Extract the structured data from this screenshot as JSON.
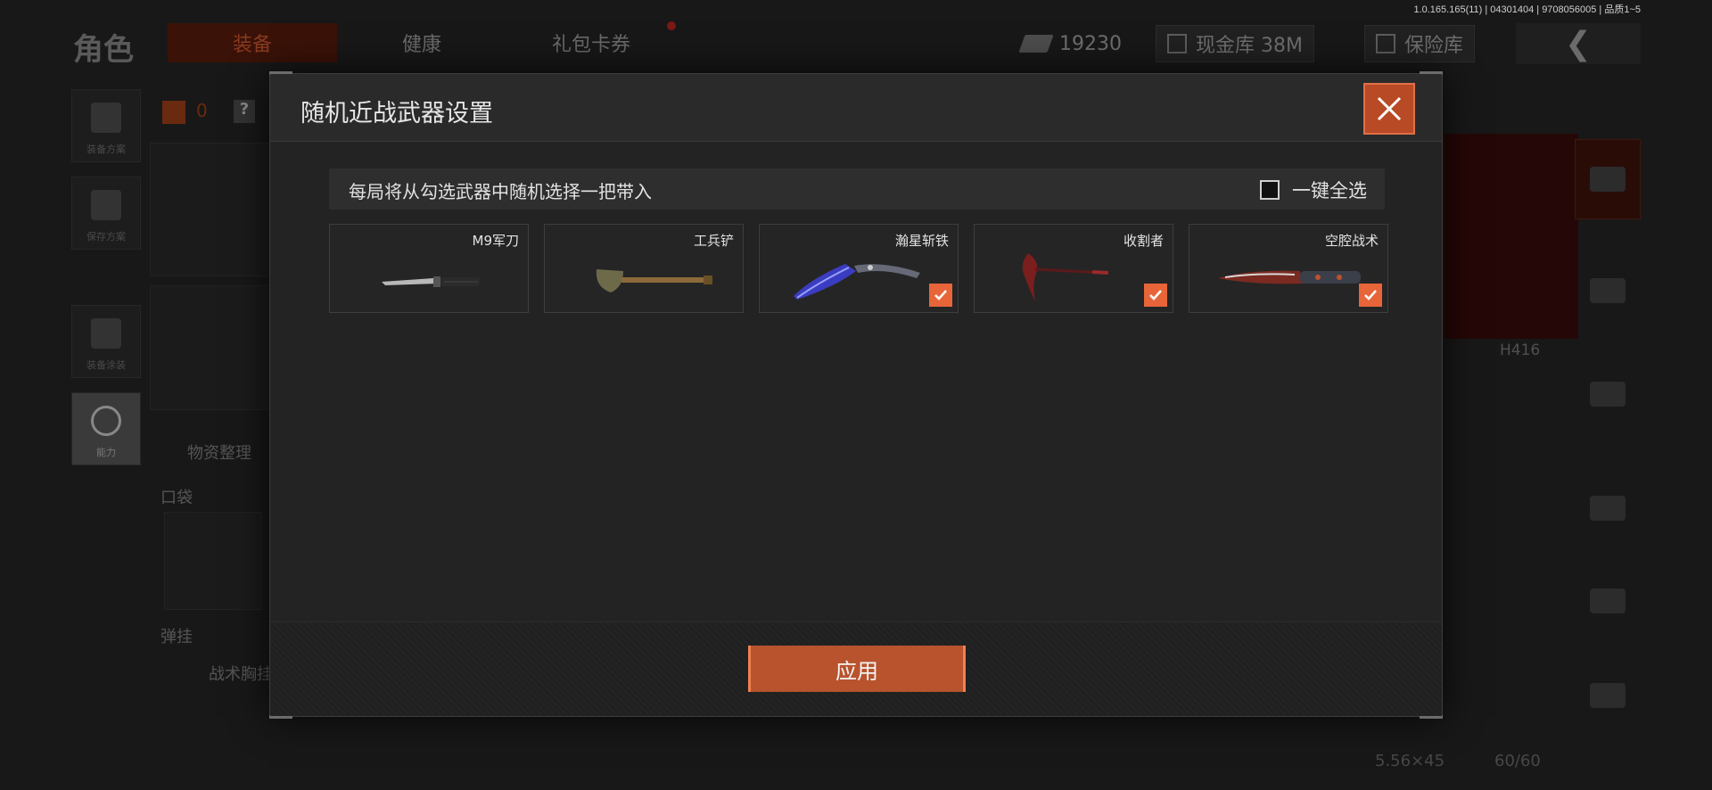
{
  "version": "1.0.165.165(11) | 04301404 | 9708056005 | 品质1~5",
  "background": {
    "role_title": "角色",
    "tabs": [
      "装备",
      "健康",
      "礼包卡券"
    ],
    "currency_value": "19230",
    "cash_vault": "现金库 38M",
    "safe_vault": "保险库",
    "side_slots": [
      "装备方案",
      "保存方案",
      "装备涂装",
      "能力"
    ],
    "zero_count": "0",
    "help": "?",
    "supplies": "物资整理",
    "pocket": "口袋",
    "rig": "弹挂",
    "tactical_chest": "战术胸挂",
    "weapon_name": "H416",
    "ammo_type": "5.56×45",
    "ammo_count": "60/60"
  },
  "modal": {
    "title": "随机近战武器设置",
    "hint": "每局将从勾选武器中随机选择一把带入",
    "select_all_label": "一键全选",
    "select_all_checked": false,
    "apply_label": "应用"
  },
  "weapons": [
    {
      "name": "M9军刀",
      "icon": "bayonet-knife",
      "checked": false
    },
    {
      "name": "工兵铲",
      "icon": "shovel",
      "checked": false
    },
    {
      "name": "瀚星斩铁",
      "icon": "karambit-blade",
      "checked": true
    },
    {
      "name": "收割者",
      "icon": "sickle",
      "checked": true
    },
    {
      "name": "空腔战术",
      "icon": "tactical-knife",
      "checked": true
    }
  ],
  "colors": {
    "accent": "#e8653a",
    "button": "#b8532e",
    "panel": "#232323"
  }
}
